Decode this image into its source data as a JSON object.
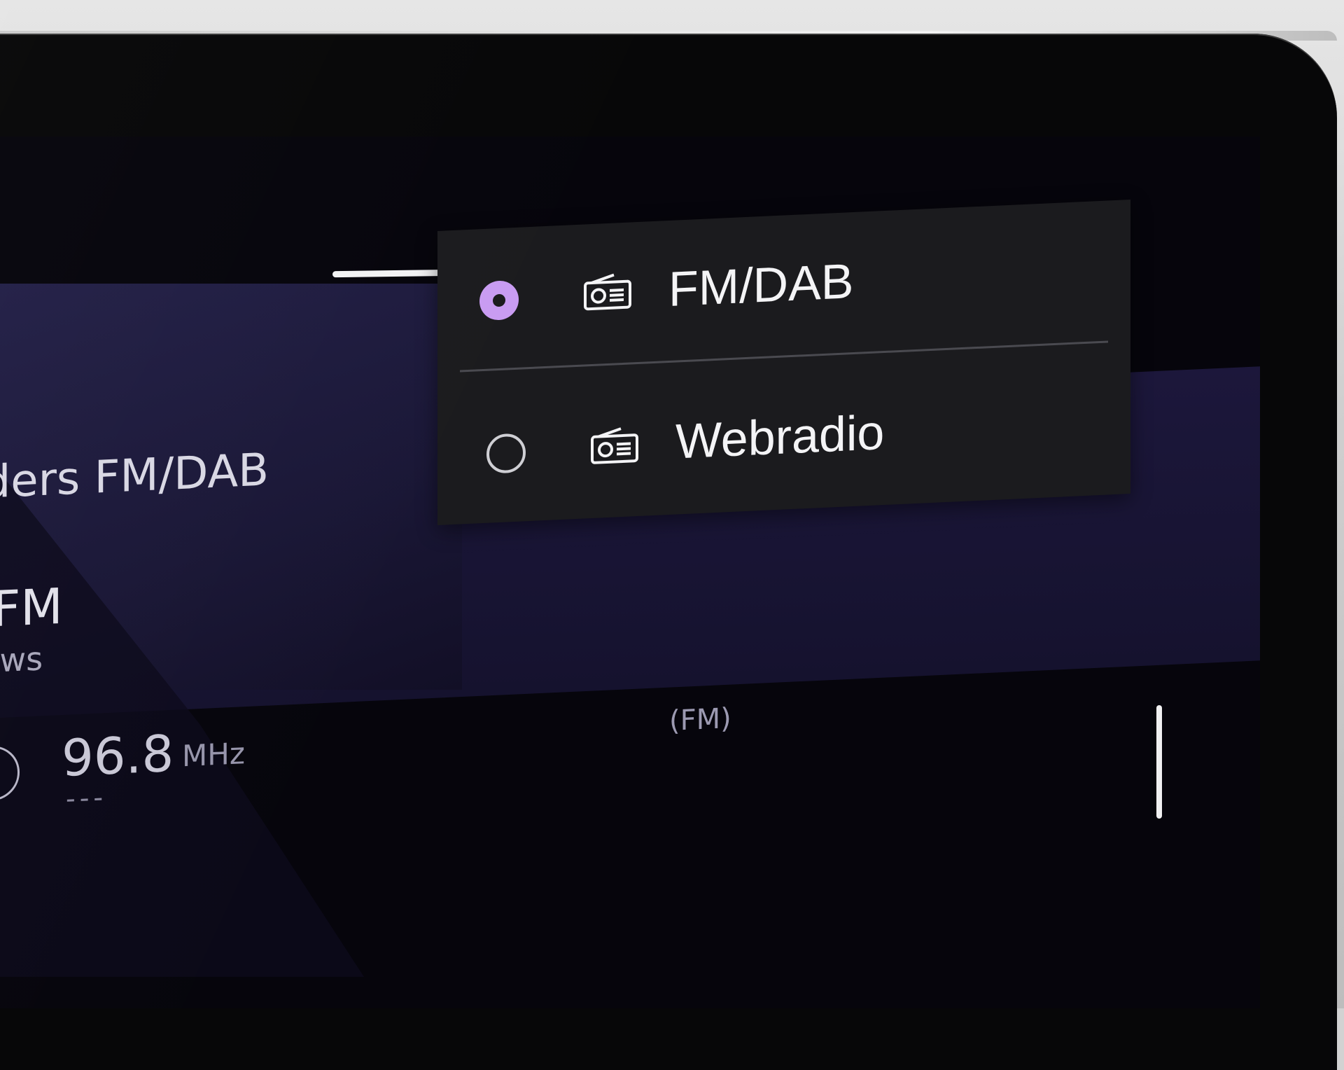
{
  "left_panel": {
    "group_title": "nders FM/DAB",
    "station_name": "ckFM",
    "station_subtitle": "euws",
    "frequency_value": "96.8",
    "frequency_unit": "MHz",
    "frequency_placeholder": "---",
    "play_symbol": "⟫"
  },
  "band_label": "(FM)",
  "source_menu": {
    "items": [
      {
        "label": "FM/DAB",
        "icon": "radio-icon",
        "selected": true
      },
      {
        "label": "Webradio",
        "icon": "radio-icon",
        "selected": false
      }
    ]
  },
  "colors": {
    "accent": "#c99cf2",
    "menu_background": "#1b1b1e",
    "screen_background": "#06050c",
    "panel_purple": "#1c173b"
  }
}
